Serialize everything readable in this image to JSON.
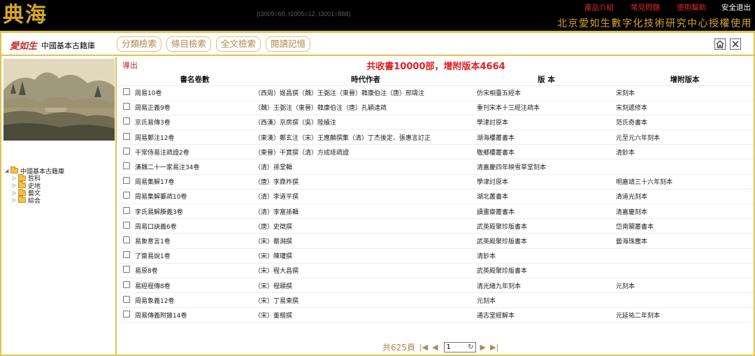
{
  "app": {
    "logo": "典海",
    "timing": "(t3009=60, t1005=12, t3001=888)",
    "nav": [
      "產品介紹",
      "常見問題",
      "使用幫助"
    ],
    "logout": "安全退出",
    "license": "北京愛如生數字化技術研究中心授權使用"
  },
  "brand": {
    "mark": "愛如生",
    "name": "中國基本古籍庫"
  },
  "tabs": [
    "分類檢索",
    "條目檢索",
    "全文檢索",
    "閱讀記憶"
  ],
  "icons": {
    "home": "home-icon",
    "close": "close-icon"
  },
  "sidebar": {
    "tree_root": "中國基本古籍庫",
    "tree_items": [
      "哲科",
      "史地",
      "藝文",
      "綜合"
    ]
  },
  "main": {
    "export_label": "導出",
    "summary": "共收書10000部，增附版本4664",
    "columns": [
      "書名卷數",
      "時代作者",
      "版 本",
      "增附版本"
    ],
    "rows": [
      [
        "周易10卷",
        "（西周）姬昌撰（魏）王弼注（東晉）韓康伯注（唐）邢璹注",
        "仿宋相臺五經本",
        "宋刻本"
      ],
      [
        "周易正義9卷",
        "（魏）王弼注（東晉）韓康伯注（唐）孔穎達疏",
        "重刊宋本十三經注疏本",
        "宋刻遞修本"
      ],
      [
        "京氏易傳3卷",
        "（西漢）京房撰（吳）陸績注",
        "學津討原本",
        "范氏奇書本"
      ],
      [
        "周易鄭注12卷",
        "（東漢）鄭玄注（宋）王應麟撰集（清）丁杰後定、張惠言訂正",
        "湖海樓叢書本",
        "元至元六年刻本"
      ],
      [
        "干常侍易注疏證2卷",
        "（東晉）干寶撰（清）方成珪疏證",
        "敬鄉樓叢書本",
        "清鈔本"
      ],
      [
        "漢魏二十一家易注34卷",
        "（清）孫堂輯",
        "清嘉慶四年映雪草堂刻本",
        ""
      ],
      [
        "周易集解17卷",
        "（唐）李鼎祚撰",
        "學津討原本",
        "明嘉靖三十六年刻本"
      ],
      [
        "周易集解纂疏10卷",
        "（清）李道平撰",
        "湖北叢書本",
        "清道光刻本"
      ],
      [
        "李氏易解賸義3卷",
        "（清）李富孫輯",
        "讀畫齋叢書本",
        "清嘉慶刻本"
      ],
      [
        "周易口訣義6卷",
        "（唐）史徵撰",
        "武英殿聚珍版書本",
        "岱南閣叢書本"
      ],
      [
        "易象意言1卷",
        "（宋）蔡淵撰",
        "武英殿聚珍版書本",
        "藝海珠塵本"
      ],
      [
        "了齋易說1卷",
        "（宋）陳瓘撰",
        "清鈔本",
        ""
      ],
      [
        "易原8卷",
        "（宋）程大昌撰",
        "武英殿聚珍版書本",
        ""
      ],
      [
        "易經程傳8卷",
        "（宋）程頤撰",
        "清光緒九年刻本",
        "元刻本"
      ],
      [
        "周易象義12卷",
        "（宋）丁易東撰",
        "元刻本",
        ""
      ],
      [
        "周易傳義附錄14卷",
        "（宋）董楷撰",
        "通志堂經解本",
        "元延祐二年刻本"
      ]
    ]
  },
  "pager": {
    "total_label": "共625頁",
    "page_value": "1"
  }
}
